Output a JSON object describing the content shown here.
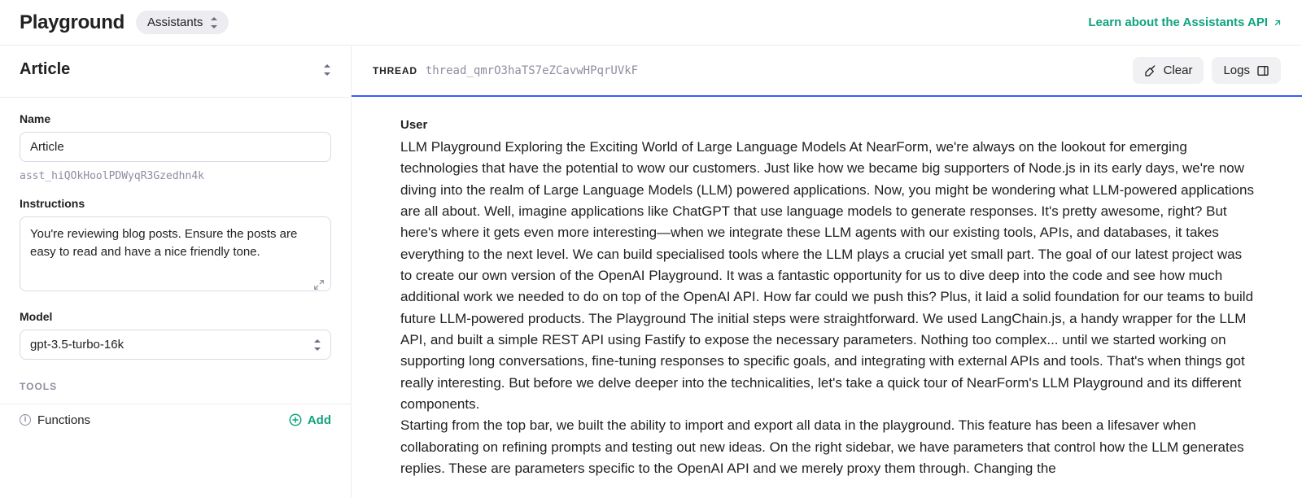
{
  "header": {
    "brand": "Playground",
    "mode_label": "Assistants",
    "learn_link": "Learn about the Assistants API"
  },
  "sidebar": {
    "title": "Article",
    "name_label": "Name",
    "name_value": "Article",
    "assistant_id": "asst_hiQOkHoolPDWyqR3Gzedhn4k",
    "instructions_label": "Instructions",
    "instructions_value": "You're reviewing blog posts. Ensure the posts are easy to read and have a nice friendly tone.",
    "model_label": "Model",
    "model_value": "gpt-3.5-turbo-16k",
    "tools_header": "TOOLS",
    "tools": {
      "functions_label": "Functions",
      "add_label": "Add"
    }
  },
  "thread": {
    "label": "THREAD",
    "id": "thread_qmrO3haTS7eZCavwHPqrUVkF",
    "clear_label": "Clear",
    "logs_label": "Logs",
    "message_role": "User",
    "message_body": "LLM Playground Exploring the Exciting World of Large Language Models At NearForm, we're always on the lookout for emerging technologies that have the potential to wow our customers. Just like how we became big supporters of Node.js in its early days, we're now diving into the realm of Large Language Models (LLM) powered applications. Now, you might be wondering what LLM-powered applications are all about. Well, imagine applications like ChatGPT that use language models to generate responses. It's pretty awesome, right? But here's where it gets even more interesting—when we integrate these LLM agents with our existing tools, APIs, and databases, it takes everything to the next level. We can build specialised tools where the LLM plays a crucial yet small part. The goal of our latest project was to create our own version of the OpenAI Playground. It was a fantastic opportunity for us to dive deep into the code and see how much additional work we needed to do on top of the OpenAI API. How far could we push this? Plus, it laid a solid foundation for our teams to build future LLM-powered products. The Playground The initial steps were straightforward. We used LangChain.js, a handy wrapper for the LLM API, and built a simple REST API using Fastify to expose the necessary parameters. Nothing too complex... until we started working on supporting long conversations, fine-tuning responses to specific goals, and integrating with external APIs and tools. That's when things got really interesting. But before we delve deeper into the technicalities, let's take a quick tour of NearForm's LLM Playground and its different components.\nStarting from the top bar, we built the ability to import and export all data in the playground. This feature has been a lifesaver when collaborating on refining prompts and testing out new ideas. On the right sidebar, we have parameters that control how the LLM generates replies. These are parameters specific to the OpenAI API and we merely proxy them through. Changing the"
  }
}
